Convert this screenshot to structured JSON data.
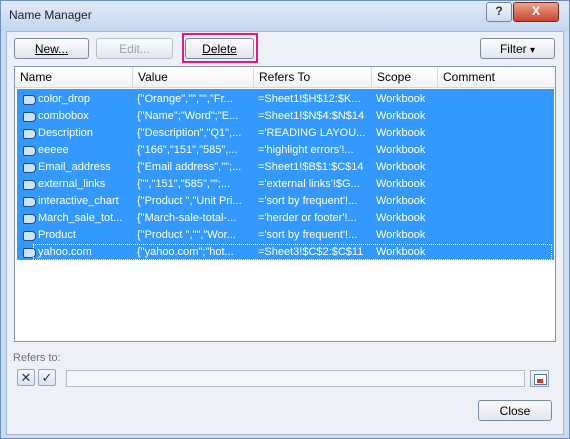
{
  "window": {
    "title": "Name Manager",
    "help_glyph": "?",
    "close_glyph": "X"
  },
  "toolbar": {
    "new_label": "New...",
    "edit_label": "Edit...",
    "delete_label": "Delete",
    "filter_label": "Filter",
    "filter_arrow": "▾"
  },
  "table": {
    "columns": [
      "Name",
      "Value",
      "Refers To",
      "Scope",
      "Comment"
    ],
    "rows": [
      {
        "name": "color_drop",
        "value": "{\"Orange\",\"\",\"\",\"Fr...",
        "refers_to": "=Sheet1!$H$12:$K...",
        "scope": "Workbook"
      },
      {
        "name": "combobox",
        "value": "{\"Name\";\"Word\";\"E...",
        "refers_to": "=Sheet1!$N$4:$N$14",
        "scope": "Workbook"
      },
      {
        "name": "Description",
        "value": "{\"Description\",\"Q1\",...",
        "refers_to": "='READING LAYOU...",
        "scope": "Workbook"
      },
      {
        "name": "eeeee",
        "value": "{\"166\",\"151\",\"585\",...",
        "refers_to": "='highlight errors'!...",
        "scope": "Workbook"
      },
      {
        "name": "Email_address",
        "value": "{\"Email address\",\"\";...",
        "refers_to": "=Sheet1!$B$1:$C$14",
        "scope": "Workbook"
      },
      {
        "name": "external_links",
        "value": "{\"\",\"151\",\"585\",\"\";...",
        "refers_to": "='external links'!$G...",
        "scope": "Workbook"
      },
      {
        "name": "interactive_chart",
        "value": "{\"Product \",\"Unit Pri...",
        "refers_to": "='sort by frequent'!...",
        "scope": "Workbook"
      },
      {
        "name": "March_sale_tot...",
        "value": "{\"March-sale-total-...",
        "refers_to": "='herder or footer'!...",
        "scope": "Workbook"
      },
      {
        "name": "Product",
        "value": "{\"Product \",\"\",\"Wor...",
        "refers_to": "='sort by frequent'!...",
        "scope": "Workbook"
      },
      {
        "name": "yahoo.com",
        "value": "{\"yahoo.com\";\"hot...",
        "refers_to": "=Sheet3!$C$2:$C$11",
        "scope": "Workbook"
      }
    ]
  },
  "refers_to": {
    "label": "Refers to:",
    "value": "",
    "cancel_glyph": "✕",
    "confirm_glyph": "✓"
  },
  "footer": {
    "close_label": "Close"
  },
  "colors": {
    "selection": "#3399ff",
    "highlight_box": "#e5197d"
  }
}
